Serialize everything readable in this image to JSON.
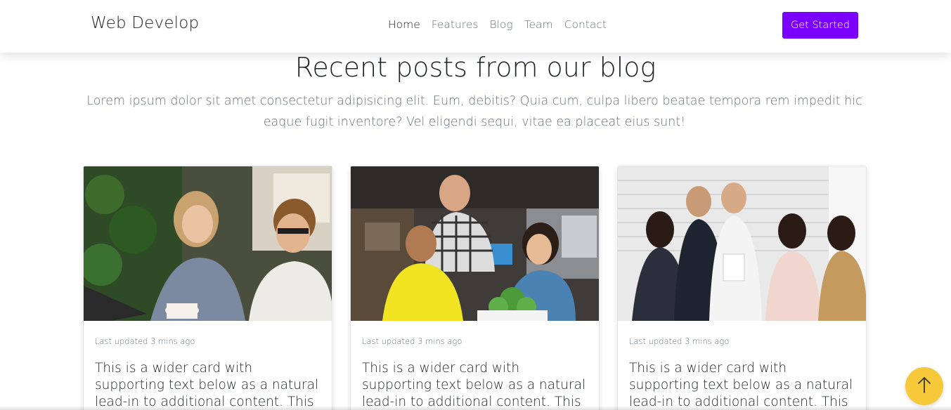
{
  "nav": {
    "brand": "Web Develop",
    "links": [
      "Home",
      "Features",
      "Blog",
      "Team",
      "Contact"
    ],
    "active_link": "Home",
    "cta_label": "Get Started"
  },
  "blog": {
    "title": "Recent posts from our blog",
    "subtitle": "Lorem ipsum dolor sit amet consectetur adipisicing elit. Eum, debitis? Quia cum, culpa libero beatae tempora rem impedit hic eaque fugit inventore? Vel eligendi sequi, vitae ea placeat eius sunt!",
    "cards": [
      {
        "meta": "Last updated 3 mins ago",
        "text": "This is a wider card with supporting text below as a natural lead-in to additional content. This content is a"
      },
      {
        "meta": "Last updated 3 mins ago",
        "text": "This is a wider card with supporting text below as a natural lead-in to additional content. This content is a"
      },
      {
        "meta": "Last updated 3 mins ago",
        "text": "This is a wider card with supporting text below as a natural lead-in to additional content. This content is a"
      }
    ]
  },
  "icons": {
    "scroll_top": "arrow-up-icon"
  },
  "colors": {
    "accent": "#7a00ff",
    "scroll_top": "#f7c83a"
  }
}
